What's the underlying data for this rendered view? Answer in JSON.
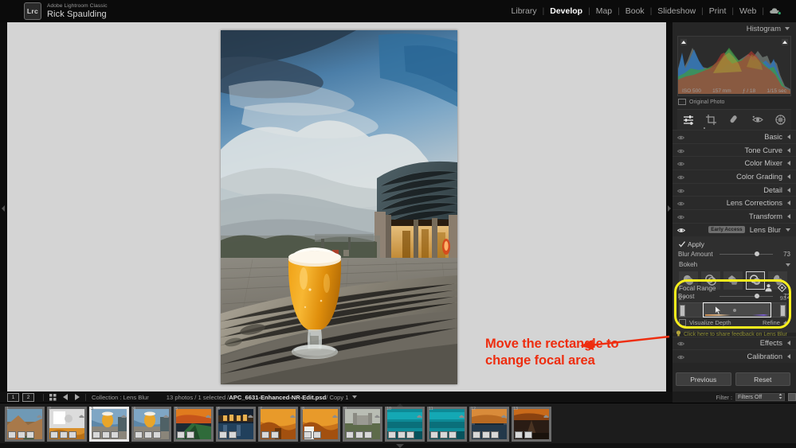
{
  "app": {
    "logo_text": "Lrc",
    "subtitle": "Adobe Lightroom Classic",
    "user_name": "Rick Spaulding"
  },
  "modules": [
    {
      "label": "Library",
      "active": false
    },
    {
      "label": "Develop",
      "active": true
    },
    {
      "label": "Map",
      "active": false
    },
    {
      "label": "Book",
      "active": false
    },
    {
      "label": "Slideshow",
      "active": false
    },
    {
      "label": "Print",
      "active": false
    },
    {
      "label": "Web",
      "active": false
    }
  ],
  "module_separator": "|",
  "cloud_icon": "cloud-sync-icon",
  "histogram": {
    "title": "Histogram",
    "iso": "ISO 500",
    "focal_length": "157 mm",
    "aperture": "ƒ / 18",
    "shutter": "1/15 sec",
    "original_photo_label": "Original Photo"
  },
  "tools": [
    {
      "name": "adjustment-tool",
      "selected": true
    },
    {
      "name": "crop-tool",
      "selected": false
    },
    {
      "name": "healing-tool",
      "selected": false
    },
    {
      "name": "red-eye-tool",
      "selected": false
    },
    {
      "name": "masking-tool",
      "selected": false
    }
  ],
  "panels": [
    {
      "label": "Basic",
      "expanded": false,
      "eye_on": false
    },
    {
      "label": "Tone Curve",
      "expanded": false,
      "eye_on": false
    },
    {
      "label": "Color Mixer",
      "expanded": false,
      "eye_on": false
    },
    {
      "label": "Color Grading",
      "expanded": false,
      "eye_on": false
    },
    {
      "label": "Detail",
      "expanded": false,
      "eye_on": false
    },
    {
      "label": "Lens Corrections",
      "expanded": false,
      "eye_on": false
    },
    {
      "label": "Transform",
      "expanded": false,
      "eye_on": false
    }
  ],
  "lens_blur": {
    "badge": "Early Access",
    "title": "Lens Blur",
    "apply_label": "Apply",
    "apply_checked": true,
    "blur_amount": {
      "label": "Blur Amount",
      "value": "73",
      "percent": 73
    },
    "bokeh": {
      "label": "Bokeh",
      "selected_index": 3
    },
    "boost": {
      "label": "Boost",
      "value": "72",
      "percent": 72
    },
    "focal_range": {
      "label": "Focal Range",
      "min_value": "27",
      "max_value": "93"
    },
    "visualize_depth": {
      "label": "Visualize Depth",
      "checked": false
    },
    "refine_label": "Refine",
    "feedback_link": "Click here to share feedback on Lens Blur"
  },
  "panels_bottom": [
    {
      "label": "Effects",
      "expanded": false,
      "eye_on": false
    },
    {
      "label": "Calibration",
      "expanded": false,
      "eye_on": false
    }
  ],
  "buttons": {
    "previous": "Previous",
    "reset": "Reset"
  },
  "filter": {
    "label": "Filter :",
    "value": "Filters Off"
  },
  "toolbar": {
    "page1": "1",
    "page2": "2",
    "collection": "Collection : Lens Blur",
    "status_prefix": "13 photos / 1 selected / ",
    "filename": "APC_6631-Enhanced-NR-Edit.psd",
    "status_suffix": " / Copy 1"
  },
  "annotation": {
    "line1": "Move the rectangle to",
    "line2": "change focal area",
    "color": "#ee2d0f"
  },
  "filmstrip": {
    "selected_index": 2,
    "thumbs": [
      {
        "num": "1",
        "kind": "canyon"
      },
      {
        "num": "2",
        "kind": "docwhite"
      },
      {
        "num": "3",
        "kind": "beer"
      },
      {
        "num": "4",
        "kind": "beer"
      },
      {
        "num": "5",
        "kind": "sunsetroad"
      },
      {
        "num": "6",
        "kind": "night"
      },
      {
        "num": "7",
        "kind": "autumn"
      },
      {
        "num": "8",
        "kind": "autumn"
      },
      {
        "num": "9",
        "kind": "castle"
      },
      {
        "num": "10",
        "kind": "teal"
      },
      {
        "num": "11",
        "kind": "teal"
      },
      {
        "num": "12",
        "kind": "pier"
      },
      {
        "num": "13",
        "kind": "road"
      }
    ]
  },
  "colors": {
    "panel_bg": "#262626",
    "canvas_bg": "#d4d4d4",
    "highlight_yellow": "#f7ee1d",
    "annotation_red": "#ee2d0f"
  }
}
